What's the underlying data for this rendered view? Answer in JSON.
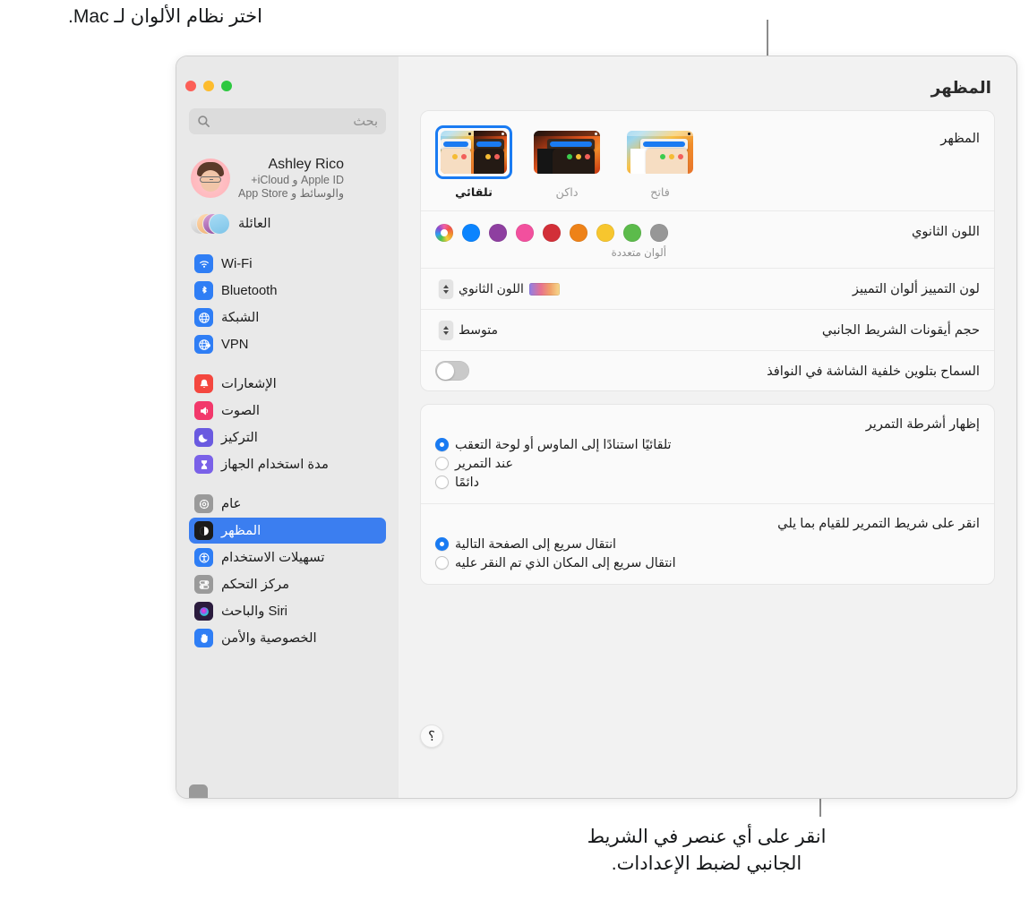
{
  "callouts": {
    "top": "اختر نظام الألوان لـ Mac.",
    "bottom": "انقر على أي عنصر في الشريط الجانبي لضبط الإعدادات."
  },
  "window": {
    "title": "المظهر",
    "traffic_lights": [
      "green",
      "yellow",
      "red"
    ],
    "colors": {
      "accent": "#3b7ef0",
      "selection": "#1a7bf2",
      "sidebar_bg": "#e9e9e9",
      "main_bg": "#f2f2f2"
    }
  },
  "sidebar": {
    "search": {
      "placeholder": "بحث",
      "value": ""
    },
    "account": {
      "name": "Ashley Rico",
      "sub_line1": "Apple ID و iCloud+",
      "sub_line2": "والوسائط و App Store"
    },
    "family": {
      "label": "العائلة"
    },
    "groups": [
      {
        "items": [
          {
            "label": "Wi-Fi",
            "icon": "wifi-icon",
            "color": "#2f7ef5",
            "selected": false
          },
          {
            "label": "Bluetooth",
            "icon": "bluetooth-icon",
            "color": "#2f7ef5",
            "selected": false
          },
          {
            "label": "الشبكة",
            "icon": "globe-icon",
            "color": "#2f7ef5",
            "selected": false
          },
          {
            "label": "VPN",
            "icon": "vpn-globe-icon",
            "color": "#2f7ef5",
            "selected": false
          }
        ]
      },
      {
        "items": [
          {
            "label": "الإشعارات",
            "icon": "bell-icon",
            "color": "#f4473f",
            "selected": false
          },
          {
            "label": "الصوت",
            "icon": "speaker-icon",
            "color": "#f2386b",
            "selected": false
          },
          {
            "label": "التركيز",
            "icon": "moon-icon",
            "color": "#6a5ae0",
            "selected": false
          },
          {
            "label": "مدة استخدام الجهاز",
            "icon": "hourglass-icon",
            "color": "#7a61e8",
            "selected": false
          }
        ]
      },
      {
        "items": [
          {
            "label": "عام",
            "icon": "gear-icon",
            "color": "#9a9a9a",
            "selected": false
          },
          {
            "label": "المظهر",
            "icon": "appearance-icon",
            "color": "#1b1b1b",
            "selected": true
          },
          {
            "label": "تسهيلات الاستخدام",
            "icon": "accessibility-icon",
            "color": "#2f7ef5",
            "selected": false
          },
          {
            "label": "مركز التحكم",
            "icon": "control-center-icon",
            "color": "#9a9a9a",
            "selected": false
          },
          {
            "label": "Siri والباحث",
            "icon": "siri-icon",
            "color": "#2a1b3d",
            "selected": false
          },
          {
            "label": "الخصوصية والأمن",
            "icon": "hand-icon",
            "color": "#2f7ef5",
            "selected": false
          }
        ]
      }
    ]
  },
  "main": {
    "appearance": {
      "label": "المظهر",
      "options": [
        {
          "id": "auto",
          "label": "تلقائي",
          "selected": true
        },
        {
          "id": "dark",
          "label": "داكن",
          "selected": false
        },
        {
          "id": "light",
          "label": "فاتح",
          "selected": false
        }
      ]
    },
    "accent": {
      "label": "اللون الثانوي",
      "caption": "ألوان متعددة",
      "swatches": [
        {
          "name": "multicolor",
          "color": "multi",
          "selected": true
        },
        {
          "name": "blue",
          "color": "#0b84fe"
        },
        {
          "name": "purple",
          "color": "#8e3fa0"
        },
        {
          "name": "pink",
          "color": "#f2509e"
        },
        {
          "name": "red",
          "color": "#d22f38"
        },
        {
          "name": "orange",
          "color": "#ee8218"
        },
        {
          "name": "yellow",
          "color": "#f7c62e"
        },
        {
          "name": "green",
          "color": "#5cbb4b"
        },
        {
          "name": "gray",
          "color": "#979797"
        }
      ]
    },
    "highlight": {
      "label": "لون التمييز ألوان التمييز",
      "value": "اللون الثانوي"
    },
    "sidebar_icon_size": {
      "label": "حجم أيقونات الشريط الجانبي",
      "value": "متوسط"
    },
    "wallpaper_tinting": {
      "label": "السماح بتلوين خلفية الشاشة في النوافذ",
      "on": false
    },
    "show_scrollbars": {
      "title": "إظهار أشرطة التمرير",
      "options": [
        {
          "label": "تلقائيًا استنادًا إلى الماوس أو لوحة التعقب",
          "selected": true
        },
        {
          "label": "عند التمرير",
          "selected": false
        },
        {
          "label": "دائمًا",
          "selected": false
        }
      ]
    },
    "scrollbar_click": {
      "title": "انقر على شريط التمرير للقيام بما يلي",
      "options": [
        {
          "label": "انتقال سريع إلى الصفحة التالية",
          "selected": true
        },
        {
          "label": "انتقال سريع إلى المكان الذي تم النقر عليه",
          "selected": false
        }
      ]
    },
    "help_button": "؟"
  }
}
